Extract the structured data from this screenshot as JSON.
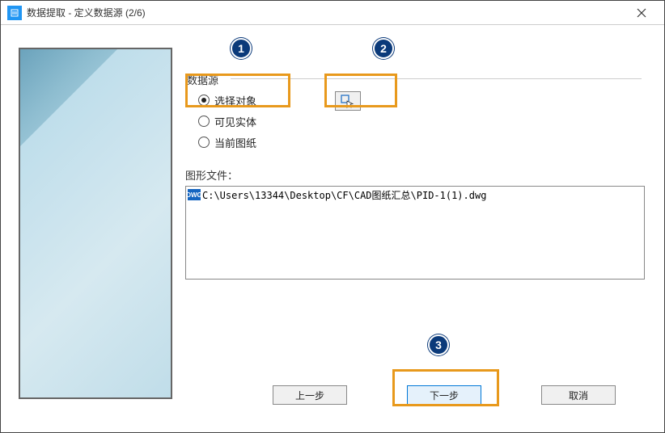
{
  "window": {
    "title": "数据提取 - 定义数据源 (2/6)"
  },
  "data_source": {
    "legend": "数据源",
    "options": {
      "select_objects": "选择对象",
      "visible_entities": "可见实体",
      "current_drawing": "当前图纸"
    },
    "selected": "select_objects"
  },
  "drawing_files": {
    "label": "图形文件：",
    "items": [
      "C:\\Users\\13344\\Desktop\\CF\\CAD图纸汇总\\PID-1(1).dwg"
    ]
  },
  "buttons": {
    "prev": "上一步",
    "next": "下一步",
    "cancel": "取消"
  },
  "annotations": {
    "badge1": "1",
    "badge2": "2",
    "badge3": "3"
  },
  "icons": {
    "file": "DWG"
  }
}
